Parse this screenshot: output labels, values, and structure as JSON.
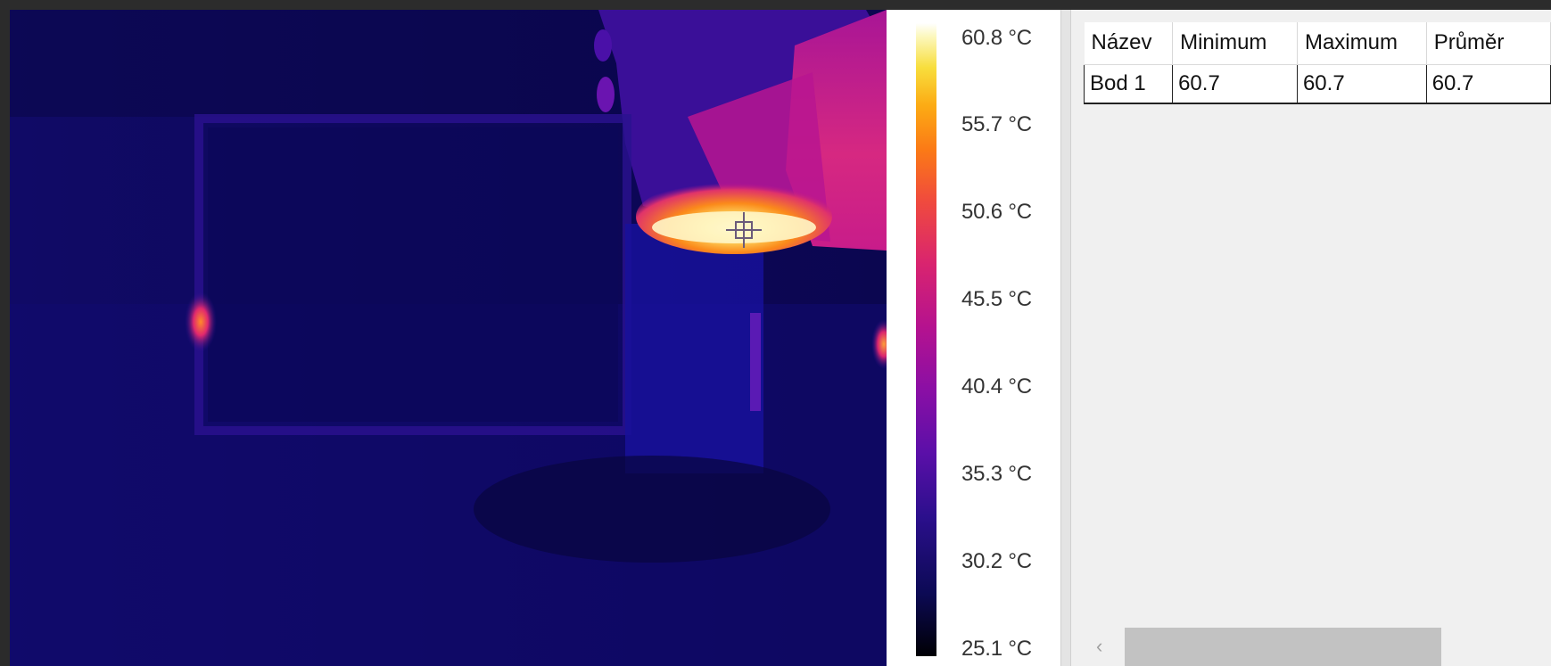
{
  "thermal_view": {
    "crosshair_icon": "crosshair-icon"
  },
  "color_scale": {
    "labels": [
      "60.8 °C",
      "55.7 °C",
      "50.6 °C",
      "45.5 °C",
      "40.4 °C",
      "35.3 °C",
      "30.2 °C",
      "25.1 °C"
    ],
    "max": 60.8,
    "min": 25.1,
    "palette": "iron"
  },
  "measurements_table": {
    "columns": [
      "Název",
      "Minimum",
      "Maximum",
      "Průměr"
    ],
    "rows": [
      {
        "name": "Bod 1",
        "minimum": "60.7",
        "maximum": "60.7",
        "average": "60.7"
      }
    ]
  },
  "scrollbar": {
    "left_arrow_icon": "chevron-left-icon",
    "left_arrow": "‹"
  }
}
